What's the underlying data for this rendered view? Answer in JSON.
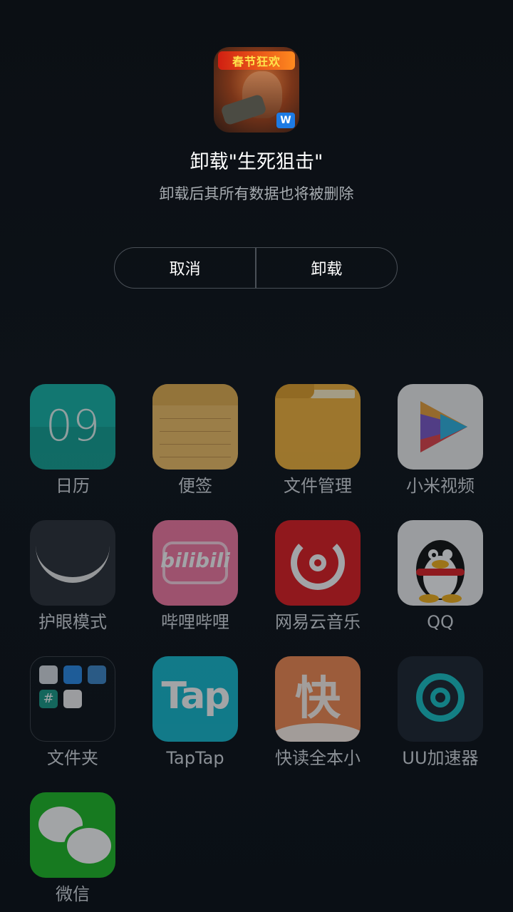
{
  "dialog": {
    "app_icon_banner": "春节狂欢",
    "app_icon_badge": "W",
    "title": "卸载\"生死狙击\"",
    "subtitle": "卸载后其所有数据也将被删除",
    "cancel_label": "取消",
    "uninstall_label": "卸载"
  },
  "apps": [
    {
      "label": "日历",
      "icon": "calendar-icon",
      "text": "09"
    },
    {
      "label": "便签",
      "icon": "notes-icon"
    },
    {
      "label": "文件管理",
      "icon": "file-manager-icon"
    },
    {
      "label": "小米视频",
      "icon": "mi-video-icon"
    },
    {
      "label": "护眼模式",
      "icon": "eye-care-icon"
    },
    {
      "label": "哔哩哔哩",
      "icon": "bilibili-icon",
      "text": "bilibili"
    },
    {
      "label": "网易云音乐",
      "icon": "netease-music-icon"
    },
    {
      "label": "QQ",
      "icon": "qq-icon"
    },
    {
      "label": "文件夹",
      "icon": "folder-icon",
      "text": "#"
    },
    {
      "label": "TapTap",
      "icon": "taptap-icon",
      "text": "Tap"
    },
    {
      "label": "快读全本小",
      "icon": "kuaidu-icon",
      "text": "快"
    },
    {
      "label": "UU加速器",
      "icon": "uu-accelerator-icon"
    },
    {
      "label": "微信",
      "icon": "wechat-icon"
    }
  ]
}
